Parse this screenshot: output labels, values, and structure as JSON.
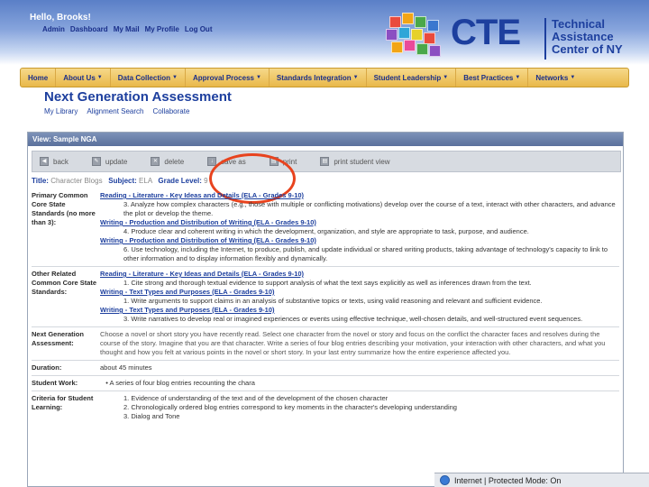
{
  "header": {
    "greeting": "Hello, Brooks!",
    "links": [
      "Admin",
      "Dashboard",
      "My Mail",
      "My Profile",
      "Log Out"
    ]
  },
  "logo": {
    "word": "CTE",
    "line1": "Technical",
    "line2": "Assistance",
    "line3": "Center of NY"
  },
  "nav": {
    "items": [
      "Home",
      "About Us",
      "Data Collection",
      "Approval Process",
      "Standards Integration",
      "Student Leadership",
      "Best Practices",
      "Networks"
    ],
    "dropdowns": [
      false,
      true,
      true,
      true,
      true,
      true,
      true,
      true
    ]
  },
  "page": {
    "title": "Next Generation Assessment",
    "sublinks": [
      "My Library",
      "Alignment Search",
      "Collaborate"
    ]
  },
  "panel": {
    "header": "View: Sample NGA",
    "toolbar": [
      "back",
      "update",
      "delete",
      "save as",
      "print",
      "print student view"
    ],
    "meta": {
      "title_label": "Title:",
      "title_value": "Character Blogs",
      "subject_label": "Subject:",
      "subject_value": "ELA",
      "grade_label": "Grade Level:",
      "grade_value": "9"
    }
  },
  "rows": {
    "primary_label": "Primary Common Core State Standards (no more than 3):",
    "primary": [
      {
        "link": "Reading - Literature - Key Ideas and Details (ELA - Grades 9-10)",
        "text": "3. Analyze how complex characters (e.g., those with multiple or conflicting motivations) develop over the course of a text, interact with other characters, and advance the plot or develop the theme."
      },
      {
        "link": "Writing - Production and Distribution of Writing (ELA - Grades 9-10)",
        "text": "4. Produce clear and coherent writing in which the development, organization, and style are appropriate to task, purpose, and audience."
      },
      {
        "link": "Writing - Production and Distribution of Writing (ELA - Grades 9-10)",
        "text": "6. Use technology, including the Internet, to produce, publish, and update individual or shared writing products, taking advantage of technology's capacity to link to other information and to display information flexibly and dynamically."
      }
    ],
    "other_label": "Other Related Common Core State Standards:",
    "other": [
      {
        "link": "Reading - Literature - Key Ideas and Details (ELA - Grades 9-10)",
        "text": "1. Cite strong and thorough textual evidence to support analysis of what the text says explicitly as well as inferences drawn from the text."
      },
      {
        "link": "Writing - Text Types and Purposes (ELA - Grades 9-10)",
        "text": "1. Write arguments to support claims in an analysis of substantive topics or texts, using valid reasoning and relevant and sufficient evidence."
      },
      {
        "link": "Writing - Text Types and Purposes (ELA - Grades 9-10)",
        "text": "3. Write narratives to develop real or imagined experiences or events using effective technique, well-chosen details, and well-structured event sequences."
      }
    ],
    "nga_label": "Next Generation Assessment:",
    "nga_text": "Choose a novel or short story you have recently read. Select one character from the novel or story and focus on the conflict the character faces and resolves during the course of the story. Imagine that you are that character. Write a series of four blog entries describing your motivation, your interaction with other characters, and what you thought and how you felt at various points in the novel or short story. In your last entry summarize how the entire experience affected you.",
    "duration_label": "Duration:",
    "duration_value": "about 45 minutes",
    "work_label": "Student Work:",
    "work_value": "A series of four blog entries recounting the chara",
    "criteria_label": "Criteria for Student Learning:",
    "criteria": [
      "1. Evidence of understanding of the text and of the development of the chosen character",
      "2. Chronologically ordered blog entries correspond to key moments in the character's developing understanding",
      "3. Dialog and Tone"
    ]
  },
  "status": {
    "text": "Internet | Protected Mode: On"
  },
  "colors": {
    "brand_blue": "#1d3f9e",
    "nav_gold": "#e9b84a",
    "highlight_red": "#e8431e"
  }
}
